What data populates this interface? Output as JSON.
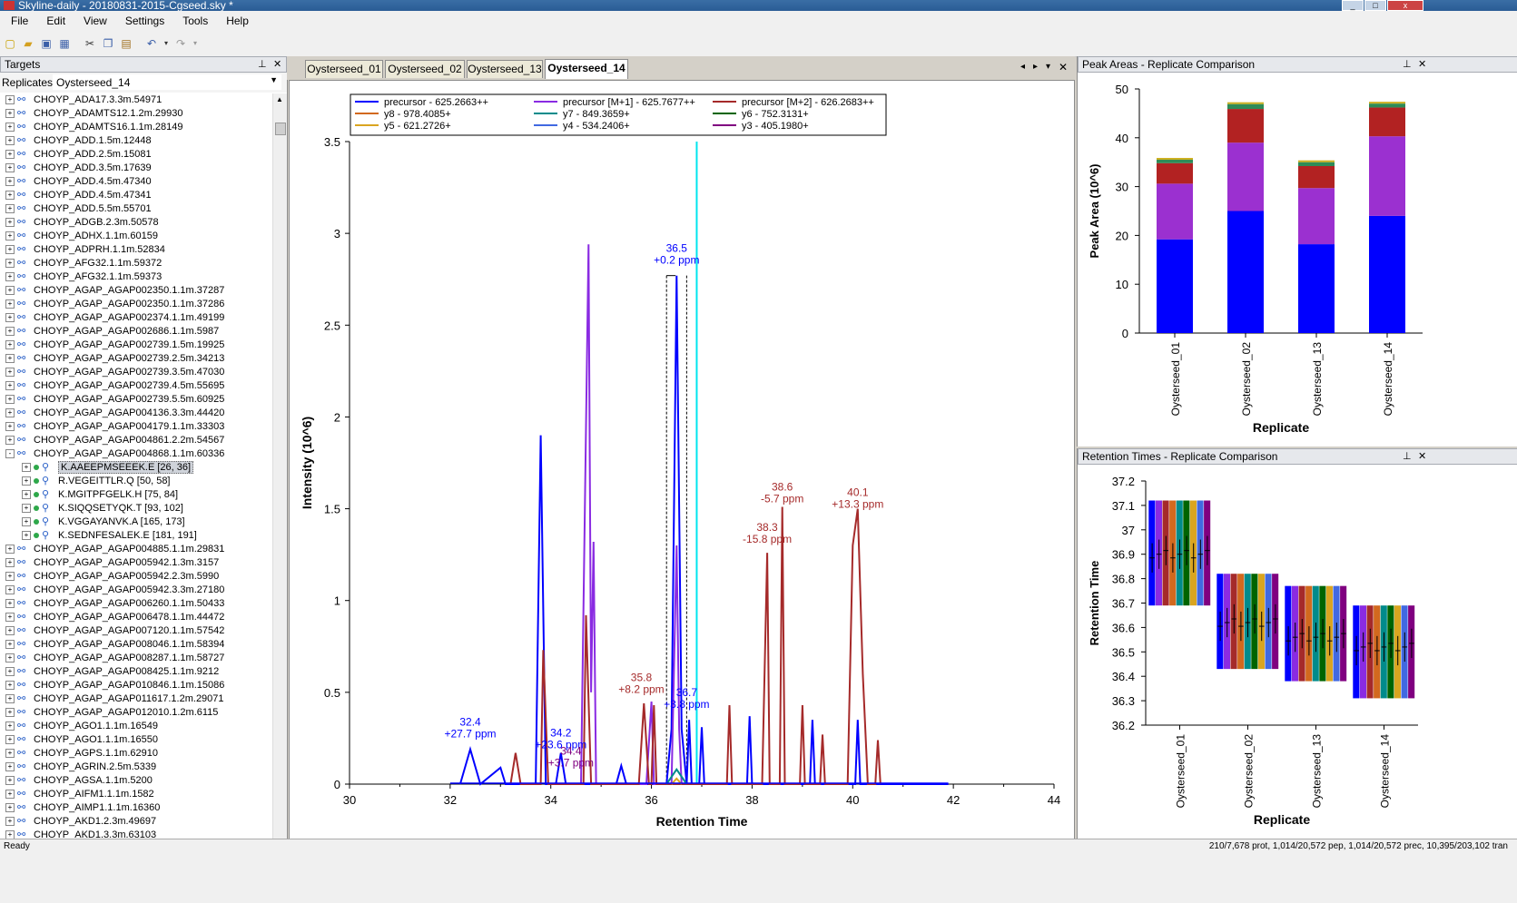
{
  "window": {
    "title": "Skyline-daily - 20180831-2015-Cgseed.sky *"
  },
  "menu": [
    "File",
    "Edit",
    "View",
    "Settings",
    "Tools",
    "Help"
  ],
  "targets_panel": {
    "title": "Targets",
    "replicates_label": "Replicates:",
    "replicate_value": "Oysterseed_14",
    "items": [
      {
        "label": "CHOYP_ADA17.3.3m.54971",
        "level": 0,
        "exp": "+"
      },
      {
        "label": "CHOYP_ADAMTS12.1.2m.29930",
        "level": 0,
        "exp": "+"
      },
      {
        "label": "CHOYP_ADAMTS16.1.1m.28149",
        "level": 0,
        "exp": "+"
      },
      {
        "label": "CHOYP_ADD.1.5m.12448",
        "level": 0,
        "exp": "+"
      },
      {
        "label": "CHOYP_ADD.2.5m.15081",
        "level": 0,
        "exp": "+"
      },
      {
        "label": "CHOYP_ADD.3.5m.17639",
        "level": 0,
        "exp": "+"
      },
      {
        "label": "CHOYP_ADD.4.5m.47340",
        "level": 0,
        "exp": "+"
      },
      {
        "label": "CHOYP_ADD.4.5m.47341",
        "level": 0,
        "exp": "+"
      },
      {
        "label": "CHOYP_ADD.5.5m.55701",
        "level": 0,
        "exp": "+"
      },
      {
        "label": "CHOYP_ADGB.2.3m.50578",
        "level": 0,
        "exp": "+"
      },
      {
        "label": "CHOYP_ADHX.1.1m.60159",
        "level": 0,
        "exp": "+"
      },
      {
        "label": "CHOYP_ADPRH.1.1m.52834",
        "level": 0,
        "exp": "+"
      },
      {
        "label": "CHOYP_AFG32.1.1m.59372",
        "level": 0,
        "exp": "+"
      },
      {
        "label": "CHOYP_AFG32.1.1m.59373",
        "level": 0,
        "exp": "+"
      },
      {
        "label": "CHOYP_AGAP_AGAP002350.1.1m.37287",
        "level": 0,
        "exp": "+"
      },
      {
        "label": "CHOYP_AGAP_AGAP002350.1.1m.37286",
        "level": 0,
        "exp": "+"
      },
      {
        "label": "CHOYP_AGAP_AGAP002374.1.1m.49199",
        "level": 0,
        "exp": "+"
      },
      {
        "label": "CHOYP_AGAP_AGAP002686.1.1m.5987",
        "level": 0,
        "exp": "+"
      },
      {
        "label": "CHOYP_AGAP_AGAP002739.1.5m.19925",
        "level": 0,
        "exp": "+"
      },
      {
        "label": "CHOYP_AGAP_AGAP002739.2.5m.34213",
        "level": 0,
        "exp": "+"
      },
      {
        "label": "CHOYP_AGAP_AGAP002739.3.5m.47030",
        "level": 0,
        "exp": "+"
      },
      {
        "label": "CHOYP_AGAP_AGAP002739.4.5m.55695",
        "level": 0,
        "exp": "+"
      },
      {
        "label": "CHOYP_AGAP_AGAP002739.5.5m.60925",
        "level": 0,
        "exp": "+"
      },
      {
        "label": "CHOYP_AGAP_AGAP004136.3.3m.44420",
        "level": 0,
        "exp": "+"
      },
      {
        "label": "CHOYP_AGAP_AGAP004179.1.1m.33303",
        "level": 0,
        "exp": "+"
      },
      {
        "label": "CHOYP_AGAP_AGAP004861.2.2m.54567",
        "level": 0,
        "exp": "+"
      },
      {
        "label": "CHOYP_AGAP_AGAP004868.1.1m.60336",
        "level": 0,
        "exp": "-"
      },
      {
        "label": "K.AAEEPMSEEEK.E [26, 36]",
        "level": 1,
        "exp": "+",
        "selected": true
      },
      {
        "label": "R.VEGEITTLR.Q [50, 58]",
        "level": 1,
        "exp": "+"
      },
      {
        "label": "K.MGITPFGELK.H [75, 84]",
        "level": 1,
        "exp": "+"
      },
      {
        "label": "K.SIQQSETYQK.T [93, 102]",
        "level": 1,
        "exp": "+"
      },
      {
        "label": "K.VGGAYANVK.A [165, 173]",
        "level": 1,
        "exp": "+"
      },
      {
        "label": "K.SEDNFESALEK.E [181, 191]",
        "level": 1,
        "exp": "+"
      },
      {
        "label": "CHOYP_AGAP_AGAP004885.1.1m.29831",
        "level": 0,
        "exp": "+"
      },
      {
        "label": "CHOYP_AGAP_AGAP005942.1.3m.3157",
        "level": 0,
        "exp": "+"
      },
      {
        "label": "CHOYP_AGAP_AGAP005942.2.3m.5990",
        "level": 0,
        "exp": "+"
      },
      {
        "label": "CHOYP_AGAP_AGAP005942.3.3m.27180",
        "level": 0,
        "exp": "+"
      },
      {
        "label": "CHOYP_AGAP_AGAP006260.1.1m.50433",
        "level": 0,
        "exp": "+"
      },
      {
        "label": "CHOYP_AGAP_AGAP006478.1.1m.44472",
        "level": 0,
        "exp": "+"
      },
      {
        "label": "CHOYP_AGAP_AGAP007120.1.1m.57542",
        "level": 0,
        "exp": "+"
      },
      {
        "label": "CHOYP_AGAP_AGAP008046.1.1m.58394",
        "level": 0,
        "exp": "+"
      },
      {
        "label": "CHOYP_AGAP_AGAP008287.1.1m.58727",
        "level": 0,
        "exp": "+"
      },
      {
        "label": "CHOYP_AGAP_AGAP008425.1.1m.9212",
        "level": 0,
        "exp": "+"
      },
      {
        "label": "CHOYP_AGAP_AGAP010846.1.1m.15086",
        "level": 0,
        "exp": "+"
      },
      {
        "label": "CHOYP_AGAP_AGAP011617.1.2m.29071",
        "level": 0,
        "exp": "+"
      },
      {
        "label": "CHOYP_AGAP_AGAP012010.1.2m.6115",
        "level": 0,
        "exp": "+"
      },
      {
        "label": "CHOYP_AGO1.1.1m.16549",
        "level": 0,
        "exp": "+"
      },
      {
        "label": "CHOYP_AGO1.1.1m.16550",
        "level": 0,
        "exp": "+"
      },
      {
        "label": "CHOYP_AGPS.1.1m.62910",
        "level": 0,
        "exp": "+"
      },
      {
        "label": "CHOYP_AGRIN.2.5m.5339",
        "level": 0,
        "exp": "+"
      },
      {
        "label": "CHOYP_AGSA.1.1m.5200",
        "level": 0,
        "exp": "+"
      },
      {
        "label": "CHOYP_AIFM1.1.1m.1582",
        "level": 0,
        "exp": "+"
      },
      {
        "label": "CHOYP_AIMP1.1.1m.16360",
        "level": 0,
        "exp": "+"
      },
      {
        "label": "CHOYP_AKD1.2.3m.49697",
        "level": 0,
        "exp": "+"
      },
      {
        "label": "CHOYP_AKD1.3.3m.63103",
        "level": 0,
        "exp": "+"
      }
    ]
  },
  "doc_tabs": [
    "Oysterseed_01",
    "Oysterseed_02",
    "Oysterseed_13",
    "Oysterseed_14"
  ],
  "active_tab": 3,
  "colors": {
    "precursor": "#0000ff",
    "precursor_m1": "#8a2be2",
    "precursor_m2": "#a52a2a",
    "y8": "#d2691e",
    "y7": "#008b8b",
    "y6": "#006400",
    "y5": "#daa520",
    "y4": "#4169e1",
    "y3": "#800080",
    "bar_mid": "#9b30d0",
    "bar_red": "#b22222",
    "bar_green": "#2e8b57",
    "rt_line": "#00e5ee"
  },
  "status": {
    "text": "Ready",
    "coords": "210/7,678 prot, 1,014/20,572 pep, 1,014/20,572 prec, 10,395/203,102 tran"
  },
  "chart_data": [
    {
      "type": "line",
      "title": "",
      "xlabel": "Retention Time",
      "ylabel": "Intensity (10^6)",
      "xlim": [
        30,
        44
      ],
      "ylim": [
        0,
        3.5
      ],
      "xticks": [
        30,
        32,
        34,
        36,
        38,
        40,
        42,
        44
      ],
      "yticks": [
        0,
        0.5,
        1,
        1.5,
        2,
        2.5,
        3,
        3.5
      ],
      "legend": [
        {
          "name": "precursor - 625.2663++",
          "color": "#0000ff"
        },
        {
          "name": "precursor [M+1] - 625.7677++",
          "color": "#8a2be2"
        },
        {
          "name": "precursor [M+2] - 626.2683++",
          "color": "#a52a2a"
        },
        {
          "name": "y8 - 978.4085+",
          "color": "#d2691e"
        },
        {
          "name": "y7 - 849.3659+",
          "color": "#008b8b"
        },
        {
          "name": "y6 - 752.3131+",
          "color": "#006400"
        },
        {
          "name": "y5 - 621.2726+",
          "color": "#daa520"
        },
        {
          "name": "y4 - 534.2406+",
          "color": "#4169e1"
        },
        {
          "name": "y3 - 405.1980+",
          "color": "#800080"
        }
      ],
      "series": [
        {
          "name": "precursor - 625.2663++",
          "color": "#0000ff",
          "points": [
            [
              32.2,
              0
            ],
            [
              32.4,
              0.19
            ],
            [
              32.6,
              0
            ],
            [
              33.0,
              0.09
            ],
            [
              33.1,
              0
            ],
            [
              33.7,
              0
            ],
            [
              33.8,
              1.9
            ],
            [
              33.9,
              0
            ],
            [
              34.1,
              0
            ],
            [
              34.2,
              0.17
            ],
            [
              34.3,
              0
            ],
            [
              35.3,
              0
            ],
            [
              35.4,
              0.1
            ],
            [
              35.5,
              0
            ],
            [
              36.3,
              0
            ],
            [
              36.4,
              0.3
            ],
            [
              36.5,
              2.77
            ],
            [
              36.6,
              0.3
            ],
            [
              36.7,
              0
            ],
            [
              36.75,
              0.35
            ],
            [
              36.8,
              0
            ],
            [
              36.95,
              0
            ],
            [
              37.0,
              0.31
            ],
            [
              37.05,
              0
            ],
            [
              37.9,
              0
            ],
            [
              37.95,
              0.37
            ],
            [
              38.0,
              0
            ],
            [
              39.15,
              0
            ],
            [
              39.2,
              0.35
            ],
            [
              39.25,
              0
            ],
            [
              40.05,
              0
            ],
            [
              40.1,
              0.35
            ],
            [
              40.15,
              0
            ],
            [
              40.4,
              0
            ],
            [
              41.9,
              0
            ]
          ]
        },
        {
          "name": "precursor [M+1] - 625.7677++",
          "color": "#8a2be2",
          "points": [
            [
              34.6,
              0
            ],
            [
              34.75,
              2.94
            ],
            [
              34.8,
              0.5
            ],
            [
              34.85,
              1.32
            ],
            [
              34.9,
              0
            ],
            [
              35.9,
              0
            ],
            [
              36.0,
              0.45
            ],
            [
              36.05,
              0
            ],
            [
              36.4,
              0
            ],
            [
              36.5,
              1.3
            ],
            [
              36.55,
              0.3
            ],
            [
              36.6,
              0
            ]
          ]
        },
        {
          "name": "precursor [M+2] - 626.2683++",
          "color": "#a52a2a",
          "points": [
            [
              33.2,
              0
            ],
            [
              33.3,
              0.17
            ],
            [
              33.4,
              0
            ],
            [
              33.8,
              0
            ],
            [
              33.85,
              0.73
            ],
            [
              33.95,
              0
            ],
            [
              34.65,
              0
            ],
            [
              34.7,
              0.92
            ],
            [
              34.8,
              0
            ],
            [
              35.75,
              0
            ],
            [
              35.85,
              0.44
            ],
            [
              35.95,
              0
            ],
            [
              36.0,
              0
            ],
            [
              36.05,
              0.43
            ],
            [
              36.1,
              0
            ],
            [
              37.5,
              0
            ],
            [
              37.55,
              0.43
            ],
            [
              37.6,
              0
            ],
            [
              38.2,
              0
            ],
            [
              38.3,
              1.26
            ],
            [
              38.35,
              0
            ],
            [
              38.55,
              0
            ],
            [
              38.6,
              1.51
            ],
            [
              38.65,
              0
            ],
            [
              38.95,
              0
            ],
            [
              39.0,
              0.43
            ],
            [
              39.05,
              0
            ],
            [
              39.35,
              0
            ],
            [
              39.4,
              0.27
            ],
            [
              39.45,
              0
            ],
            [
              39.9,
              0
            ],
            [
              40.0,
              1.3
            ],
            [
              40.1,
              1.5
            ],
            [
              40.2,
              0.6
            ],
            [
              40.3,
              0
            ],
            [
              40.45,
              0
            ],
            [
              40.5,
              0.24
            ],
            [
              40.55,
              0
            ]
          ]
        },
        {
          "name": "y7 - 849.3659+",
          "color": "#008b8b",
          "points": [
            [
              36.3,
              0
            ],
            [
              36.5,
              0.08
            ],
            [
              36.7,
              0
            ]
          ]
        },
        {
          "name": "y5 - 621.2726+",
          "color": "#daa520",
          "points": [
            [
              36.4,
              0
            ],
            [
              36.5,
              0.03
            ],
            [
              36.6,
              0
            ]
          ]
        }
      ],
      "annotations": [
        {
          "x": 32.4,
          "line1": "32.4",
          "line2": "+27.7 ppm",
          "color": "#0000ff"
        },
        {
          "x": 34.2,
          "line1": "34.2",
          "line2": "+23.6 ppm",
          "color": "#0000ff"
        },
        {
          "x": 34.4,
          "line1": "34.4",
          "line2": "+3.7 ppm",
          "color": "#800080"
        },
        {
          "x": 35.8,
          "line1": "35.8",
          "line2": "+8.2 ppm",
          "color": "#a52a2a"
        },
        {
          "x": 36.5,
          "line1": "36.5",
          "line2": "+0.2 ppm",
          "color": "#0000ff"
        },
        {
          "x": 36.7,
          "line1": "36.7",
          "line2": "+3.8 ppm",
          "color": "#0000ff"
        },
        {
          "x": 38.3,
          "line1": "38.3",
          "line2": "-15.8 ppm",
          "color": "#a52a2a"
        },
        {
          "x": 38.6,
          "line1": "38.6",
          "line2": "-5.7 ppm",
          "color": "#a52a2a"
        },
        {
          "x": 40.1,
          "line1": "40.1",
          "line2": "+13.3 ppm",
          "color": "#a52a2a"
        }
      ],
      "retention_time_line": 36.9,
      "integration_bounds": [
        36.3,
        36.7
      ]
    },
    {
      "type": "bar",
      "panel_title": "Peak Areas - Replicate Comparison",
      "xlabel": "Replicate",
      "ylabel": "Peak Area (10^6)",
      "ylim": [
        0,
        50
      ],
      "yticks": [
        0,
        10,
        20,
        30,
        40,
        50
      ],
      "categories": [
        "Oysterseed_01",
        "Oysterseed_02",
        "Oysterseed_13",
        "Oysterseed_14"
      ],
      "stacked": true,
      "series": [
        {
          "color": "#0000ff",
          "values": [
            19.2,
            25.0,
            18.2,
            24.0
          ]
        },
        {
          "color": "#9b30d0",
          "values": [
            11.4,
            14.0,
            11.5,
            16.3
          ]
        },
        {
          "color": "#b22222",
          "values": [
            4.2,
            6.9,
            4.5,
            5.9
          ]
        },
        {
          "color": "#2e8b57",
          "values": [
            0.7,
            1.0,
            0.8,
            0.8
          ]
        }
      ]
    },
    {
      "type": "bar",
      "panel_title": "Retention Times - Replicate Comparison",
      "xlabel": "Replicate",
      "ylabel": "Retention Time",
      "ylim": [
        36.2,
        37.2
      ],
      "yticks": [
        36.2,
        36.3,
        36.4,
        36.5,
        36.6,
        36.7,
        36.8,
        36.9,
        37,
        37.1,
        37.2
      ],
      "categories": [
        "Oysterseed_01",
        "Oysterseed_02",
        "Oysterseed_13",
        "Oysterseed_14"
      ],
      "bar_colors": [
        "#0000ff",
        "#8a2be2",
        "#a52a2a",
        "#d2691e",
        "#008b8b",
        "#006400",
        "#daa520",
        "#4169e1",
        "#800080"
      ],
      "ranges": [
        [
          36.69,
          37.12
        ],
        [
          36.43,
          36.82
        ],
        [
          36.38,
          36.77
        ],
        [
          36.31,
          36.69
        ]
      ],
      "centers": [
        36.9,
        36.62,
        36.56,
        36.52
      ]
    }
  ]
}
